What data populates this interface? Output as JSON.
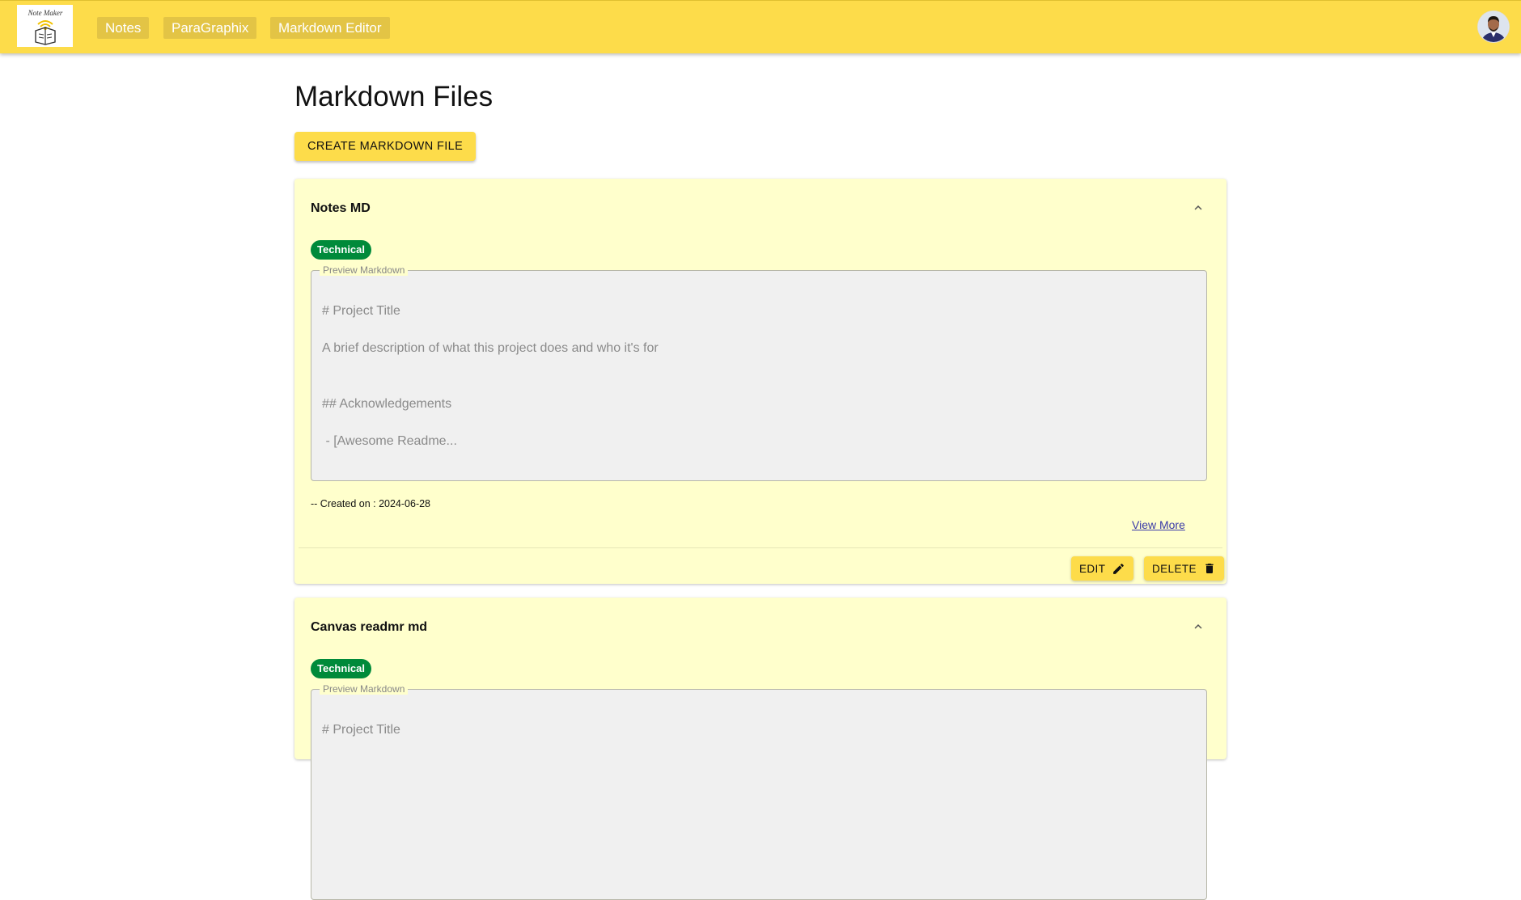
{
  "header": {
    "logo_text": "Note Maker",
    "nav": [
      {
        "label": "Notes"
      },
      {
        "label": "ParaGraphix"
      },
      {
        "label": "Markdown Editor"
      }
    ]
  },
  "page": {
    "title": "Markdown Files",
    "create_label": "CREATE MARKDOWN FILE"
  },
  "cards": [
    {
      "title": "Notes MD",
      "tag": "Technical",
      "preview_legend": "Preview Markdown",
      "preview_lines": [
        "# Project Title",
        "A brief description of what this project does and who it's for",
        "## Acknowledgements",
        " - [Awesome Readme..."
      ],
      "created": "-- Created on : 2024-06-28",
      "view_more": "View More",
      "edit_label": "EDIT",
      "delete_label": "DELETE"
    },
    {
      "title": "Canvas readmr md",
      "tag": "Technical",
      "preview_legend": "Preview Markdown",
      "preview_lines": [
        "# Project Title"
      ]
    }
  ],
  "colors": {
    "appbar": "#fddc4a",
    "card_bg": "#ffffcc",
    "tag_green": "#008a3a"
  }
}
